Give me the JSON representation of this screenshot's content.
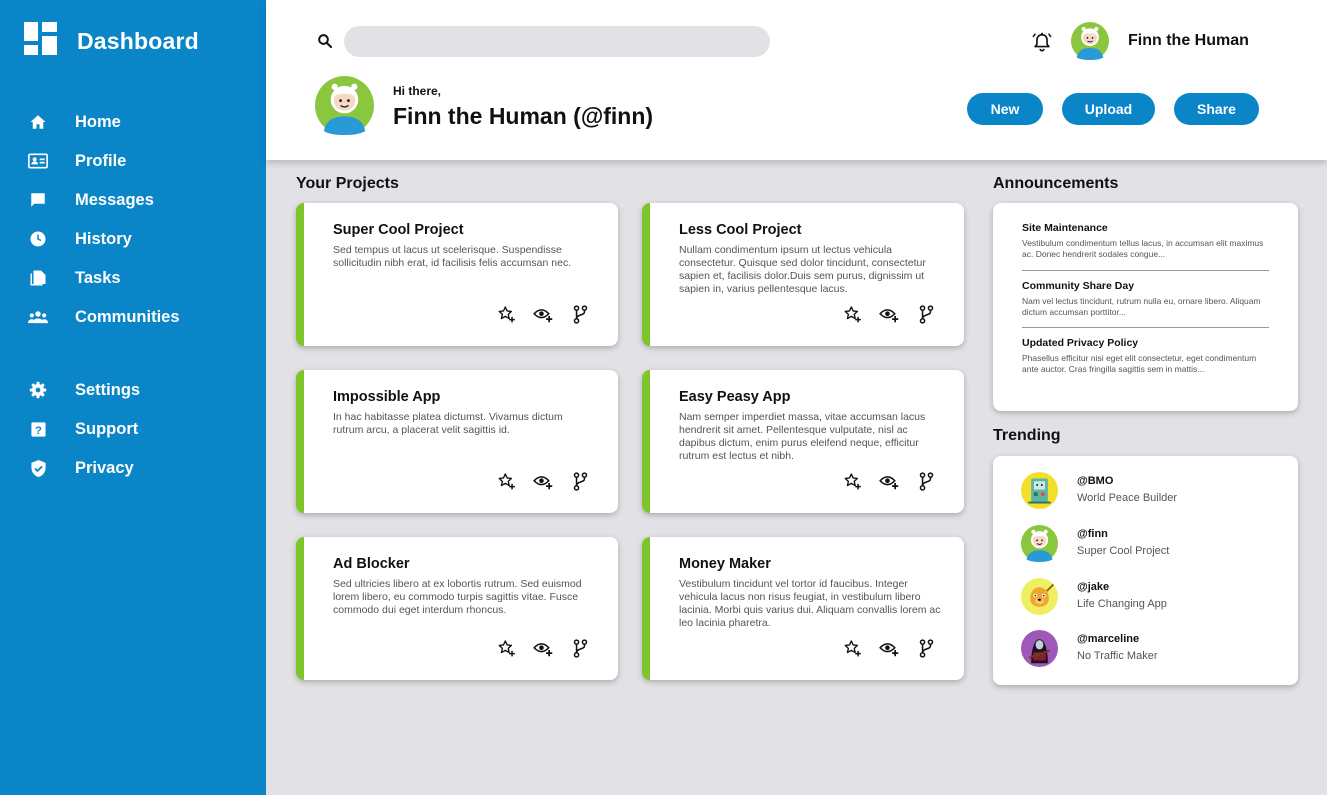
{
  "colors": {
    "brand": "#0a85c8",
    "accent": "#7ec42b",
    "background": "#e2e2e6"
  },
  "sidebar": {
    "title": "Dashboard",
    "logo_icon": "dashboard-grid-icon",
    "items": [
      {
        "label": "Home",
        "icon": "home-icon"
      },
      {
        "label": "Profile",
        "icon": "id-card-icon"
      },
      {
        "label": "Messages",
        "icon": "chat-bubble-icon"
      },
      {
        "label": "History",
        "icon": "clock-icon"
      },
      {
        "label": "Tasks",
        "icon": "documents-icon"
      },
      {
        "label": "Communities",
        "icon": "people-icon"
      },
      {
        "label": "Settings",
        "icon": "gear-icon"
      },
      {
        "label": "Support",
        "icon": "help-icon"
      },
      {
        "label": "Privacy",
        "icon": "shield-icon"
      }
    ]
  },
  "header": {
    "search": {
      "placeholder": "",
      "value": ""
    },
    "user_name": "Finn the Human",
    "greeting": "Hi there,",
    "display_name": "Finn the Human (@finn)",
    "buttons": {
      "new": "New",
      "upload": "Upload",
      "share": "Share"
    }
  },
  "projects": {
    "title": "Your Projects",
    "items": [
      {
        "title": "Super Cool Project",
        "description": "Sed tempus ut lacus ut scelerisque. Suspendisse sollicitudin nibh erat, id facilisis felis accumsan nec."
      },
      {
        "title": "Less Cool Project",
        "description": "Nullam condimentum ipsum ut lectus vehicula consectetur. Quisque sed dolor tincidunt, consectetur sapien et, facilisis dolor.Duis sem purus, dignissim ut sapien in, varius pellentesque lacus."
      },
      {
        "title": "Impossible App",
        "description": "In hac habitasse platea dictumst. Vivamus dictum rutrum arcu, a placerat velit sagittis id."
      },
      {
        "title": "Easy Peasy App",
        "description": "Nam semper imperdiet massa, vitae accumsan lacus hendrerit sit amet. Pellentesque vulputate, nisl ac dapibus dictum, enim purus eleifend neque, efficitur rutrum est lectus et nibh."
      },
      {
        "title": "Ad Blocker",
        "description": "Sed ultricies libero at ex lobortis rutrum. Sed euismod lorem libero, eu commodo turpis sagittis vitae. Fusce commodo dui eget interdum rhoncus."
      },
      {
        "title": "Money Maker",
        "description": "Vestibulum tincidunt vel tortor id faucibus. Integer vehicula lacus non risus feugiat, in vestibulum libero lacinia. Morbi quis varius dui. Aliquam convallis lorem ac leo lacinia pharetra."
      }
    ]
  },
  "announcements": {
    "title": "Announcements",
    "items": [
      {
        "title": "Site Maintenance",
        "body": "Vestibulum condimentum tellus lacus, in accumsan elit maximus ac. Donec hendrerit sodales congue..."
      },
      {
        "title": "Community Share Day",
        "body": "Nam vel lectus tincidunt, rutrum nulla eu, ornare libero. Aliquam dictum accumsan porttitor..."
      },
      {
        "title": "Updated Privacy Policy",
        "body": "Phasellus efficitur nisi eget elit consectetur, eget condimentum ante auctor. Cras fringilla sagittis sem in mattis..."
      }
    ]
  },
  "trending": {
    "title": "Trending",
    "items": [
      {
        "handle": "@BMO",
        "subtitle": "World Peace Builder"
      },
      {
        "handle": "@finn",
        "subtitle": "Super Cool Project"
      },
      {
        "handle": "@jake",
        "subtitle": "Life Changing App"
      },
      {
        "handle": "@marceline",
        "subtitle": "No Traffic Maker"
      }
    ]
  }
}
